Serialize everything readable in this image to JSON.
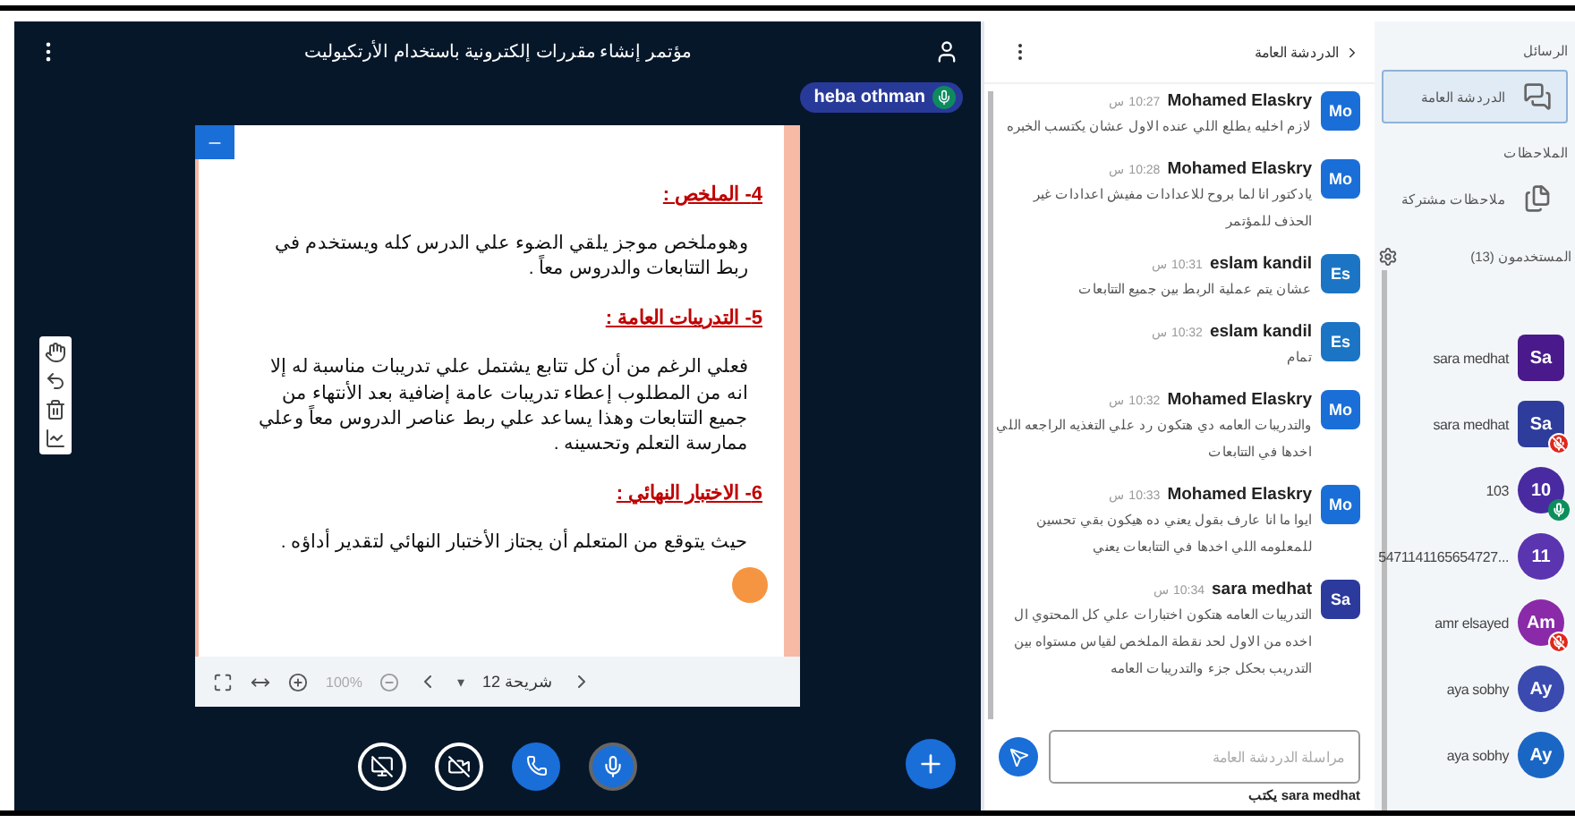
{
  "meeting": {
    "title": "مؤتمر إنشاء مقررات إلكترونية باستخدام الأرتكيوليت"
  },
  "presenter": {
    "name": "heba othman",
    "muted": false
  },
  "slide": {
    "sections": [
      {
        "heading": "4- الملخص :",
        "body": "وهوملخص موجز يلقي الضوء علي الدرس كله ويستخدم في ربط التتابعات والدروس معاً ."
      },
      {
        "heading": "5- التدريبات العامة :",
        "body": "فعلي الرغم من أن كل تتابع يشتمل علي تدريبات مناسبة له إلا انه من المطلوب إعطاء تدريبات عامة إضافية بعد الأنتهاء من جميع التتابعات وهذا يساعد علي ربط عناصر الدروس معاً وعلي ممارسة التعلم وتحسينه ."
      },
      {
        "heading": "6- الاختبار النهائي :",
        "body": "حيث يتوقع من المتعلم أن يجتاز الأختبار النهائي لتقدير أداؤه ."
      }
    ]
  },
  "slide_toolbar": {
    "zoom": "100%",
    "dropdown": "▾",
    "slide_label": "شريحة 12"
  },
  "actions": {
    "screen_sharing": false,
    "camera_on": false,
    "mic_on": true
  },
  "chat": {
    "title": "الدردشة العامة",
    "messages": [
      {
        "name": "Mohamed Elaskry",
        "initials": "Mo",
        "color": "#1a6ed8",
        "time": "10:27 س",
        "text": "لازم اخليه يطلع اللي عنده الاول عشان يكتسب الخبره"
      },
      {
        "name": "Mohamed Elaskry",
        "initials": "Mo",
        "color": "#1a6ed8",
        "time": "10:28 س",
        "text": "يادكتور انا لما بروح للاعدادات مفيش اعدادات غير الحذف للمؤتمر"
      },
      {
        "name": "eslam kandil",
        "initials": "Es",
        "color": "#1b75c4",
        "time": "10:31 س",
        "text": "عشان يتم عملية الربط بين جميع التتابعات"
      },
      {
        "name": "eslam kandil",
        "initials": "Es",
        "color": "#1b75c4",
        "time": "10:32 س",
        "text": "تمام"
      },
      {
        "name": "Mohamed Elaskry",
        "initials": "Mo",
        "color": "#1a6ed8",
        "time": "10:32 س",
        "text": "والتدريبات العامه دي هتكون رد علي التغذيه الراجعه اللي اخدها في التتابعات"
      },
      {
        "name": "Mohamed Elaskry",
        "initials": "Mo",
        "color": "#1a6ed8",
        "time": "10:33 س",
        "text": "ايوا ما انا عارف بقول يعني ده هيكون بقي تحسين للمعلومه اللي اخدها في التتابعات يعني"
      },
      {
        "name": "sara medhat",
        "initials": "Sa",
        "color": "#2b3a9c",
        "time": "10:34 س",
        "text": "التدريبات العامه هتكون اختبارات علي كل المحتوي ال اخده من الاول لحد نقطة الملخص لقياس مستواه بين التدريب بحكل جزء والتدريبات العامه"
      }
    ],
    "input": {
      "placeholder": "مراسلة الدردشة العامة"
    },
    "typing": "sara medhat يكتب"
  },
  "sidebar": {
    "messages_label": "الرسائل",
    "chats": [
      {
        "label": "الدردشة العامة",
        "selected": true
      }
    ],
    "notes_label": "الملاحظات",
    "notes": [
      {
        "label": "ملاحظات مشتركة"
      }
    ],
    "users_label": "المستخدمون (13)",
    "users": [
      {
        "name": "sara medhat",
        "initials": "Sa",
        "color": "#4a1a8c",
        "moderator": true,
        "in_audio": false
      },
      {
        "name": "sara medhat",
        "initials": "Sa",
        "color": "#2e3d9c",
        "moderator": true,
        "in_audio": true,
        "muted": true
      },
      {
        "name": "103",
        "initials": "10",
        "color": "#4a2aa0",
        "moderator": false,
        "in_audio": true,
        "muted": false
      },
      {
        "name": "...5471141165654727",
        "initials": "11",
        "color": "#5b34b0",
        "moderator": false,
        "in_audio": false
      },
      {
        "name": "amr elsayed",
        "initials": "Am",
        "color": "#8a2aa8",
        "moderator": false,
        "in_audio": true,
        "muted": true
      },
      {
        "name": "aya sobhy",
        "initials": "Ay",
        "color": "#3a4aae",
        "moderator": false,
        "in_audio": false
      },
      {
        "name": "aya sobhy",
        "initials": "Ay",
        "color": "#1a66c4",
        "moderator": false,
        "in_audio": false
      }
    ]
  }
}
